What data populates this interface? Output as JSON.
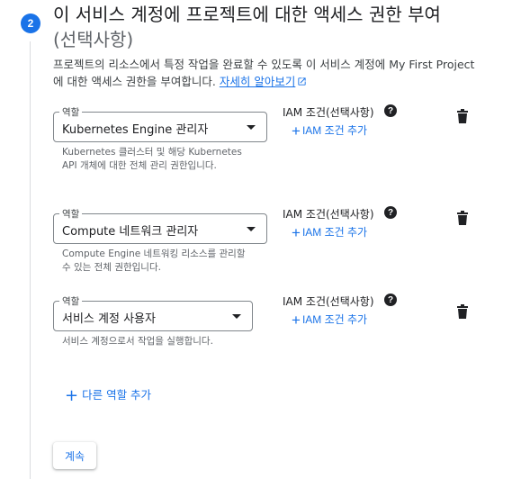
{
  "step": {
    "number": "2",
    "title": "이 서비스 계정에 프로젝트에 대한 액세스 권한 부여",
    "optional": "(선택사항)",
    "description": "프로젝트의 리소스에서 특정 작업을 완료할 수 있도록 이 서비스 계정에 My First Project에 대한 액세스 권한을 부여합니다.",
    "learn_more": "자세히 알아보기"
  },
  "roles": [
    {
      "label": "역할",
      "value": "Kubernetes Engine 관리자",
      "hint": "Kubernetes 클러스터 및 해당 Kubernetes API 개체에 대한 전체 관리 권한입니다.",
      "iam_condition": "IAM 조건(선택사항)",
      "add_iam": "IAM 조건 추가"
    },
    {
      "label": "역할",
      "value": "Compute 네트워크 관리자",
      "hint": "Compute Engine 네트워킹 리소스를 관리할 수 있는 전체 권한입니다.",
      "iam_condition": "IAM 조건(선택사항)",
      "add_iam": "IAM 조건 추가"
    },
    {
      "label": "역할",
      "value": "서비스 계정 사용자",
      "hint": "서비스 계정으로서 작업을 실행합니다.",
      "iam_condition": "IAM 조건(선택사항)",
      "add_iam": "IAM 조건 추가"
    }
  ],
  "add_role_label": "다른 역할 추가",
  "continue_label": "계속",
  "icons": {
    "help": "help-icon",
    "delete": "trash-icon",
    "external": "external-link-icon",
    "add": "plus-icon"
  },
  "colors": {
    "accent": "#1a73e8",
    "text": "#202124",
    "secondary": "#5f6368"
  }
}
